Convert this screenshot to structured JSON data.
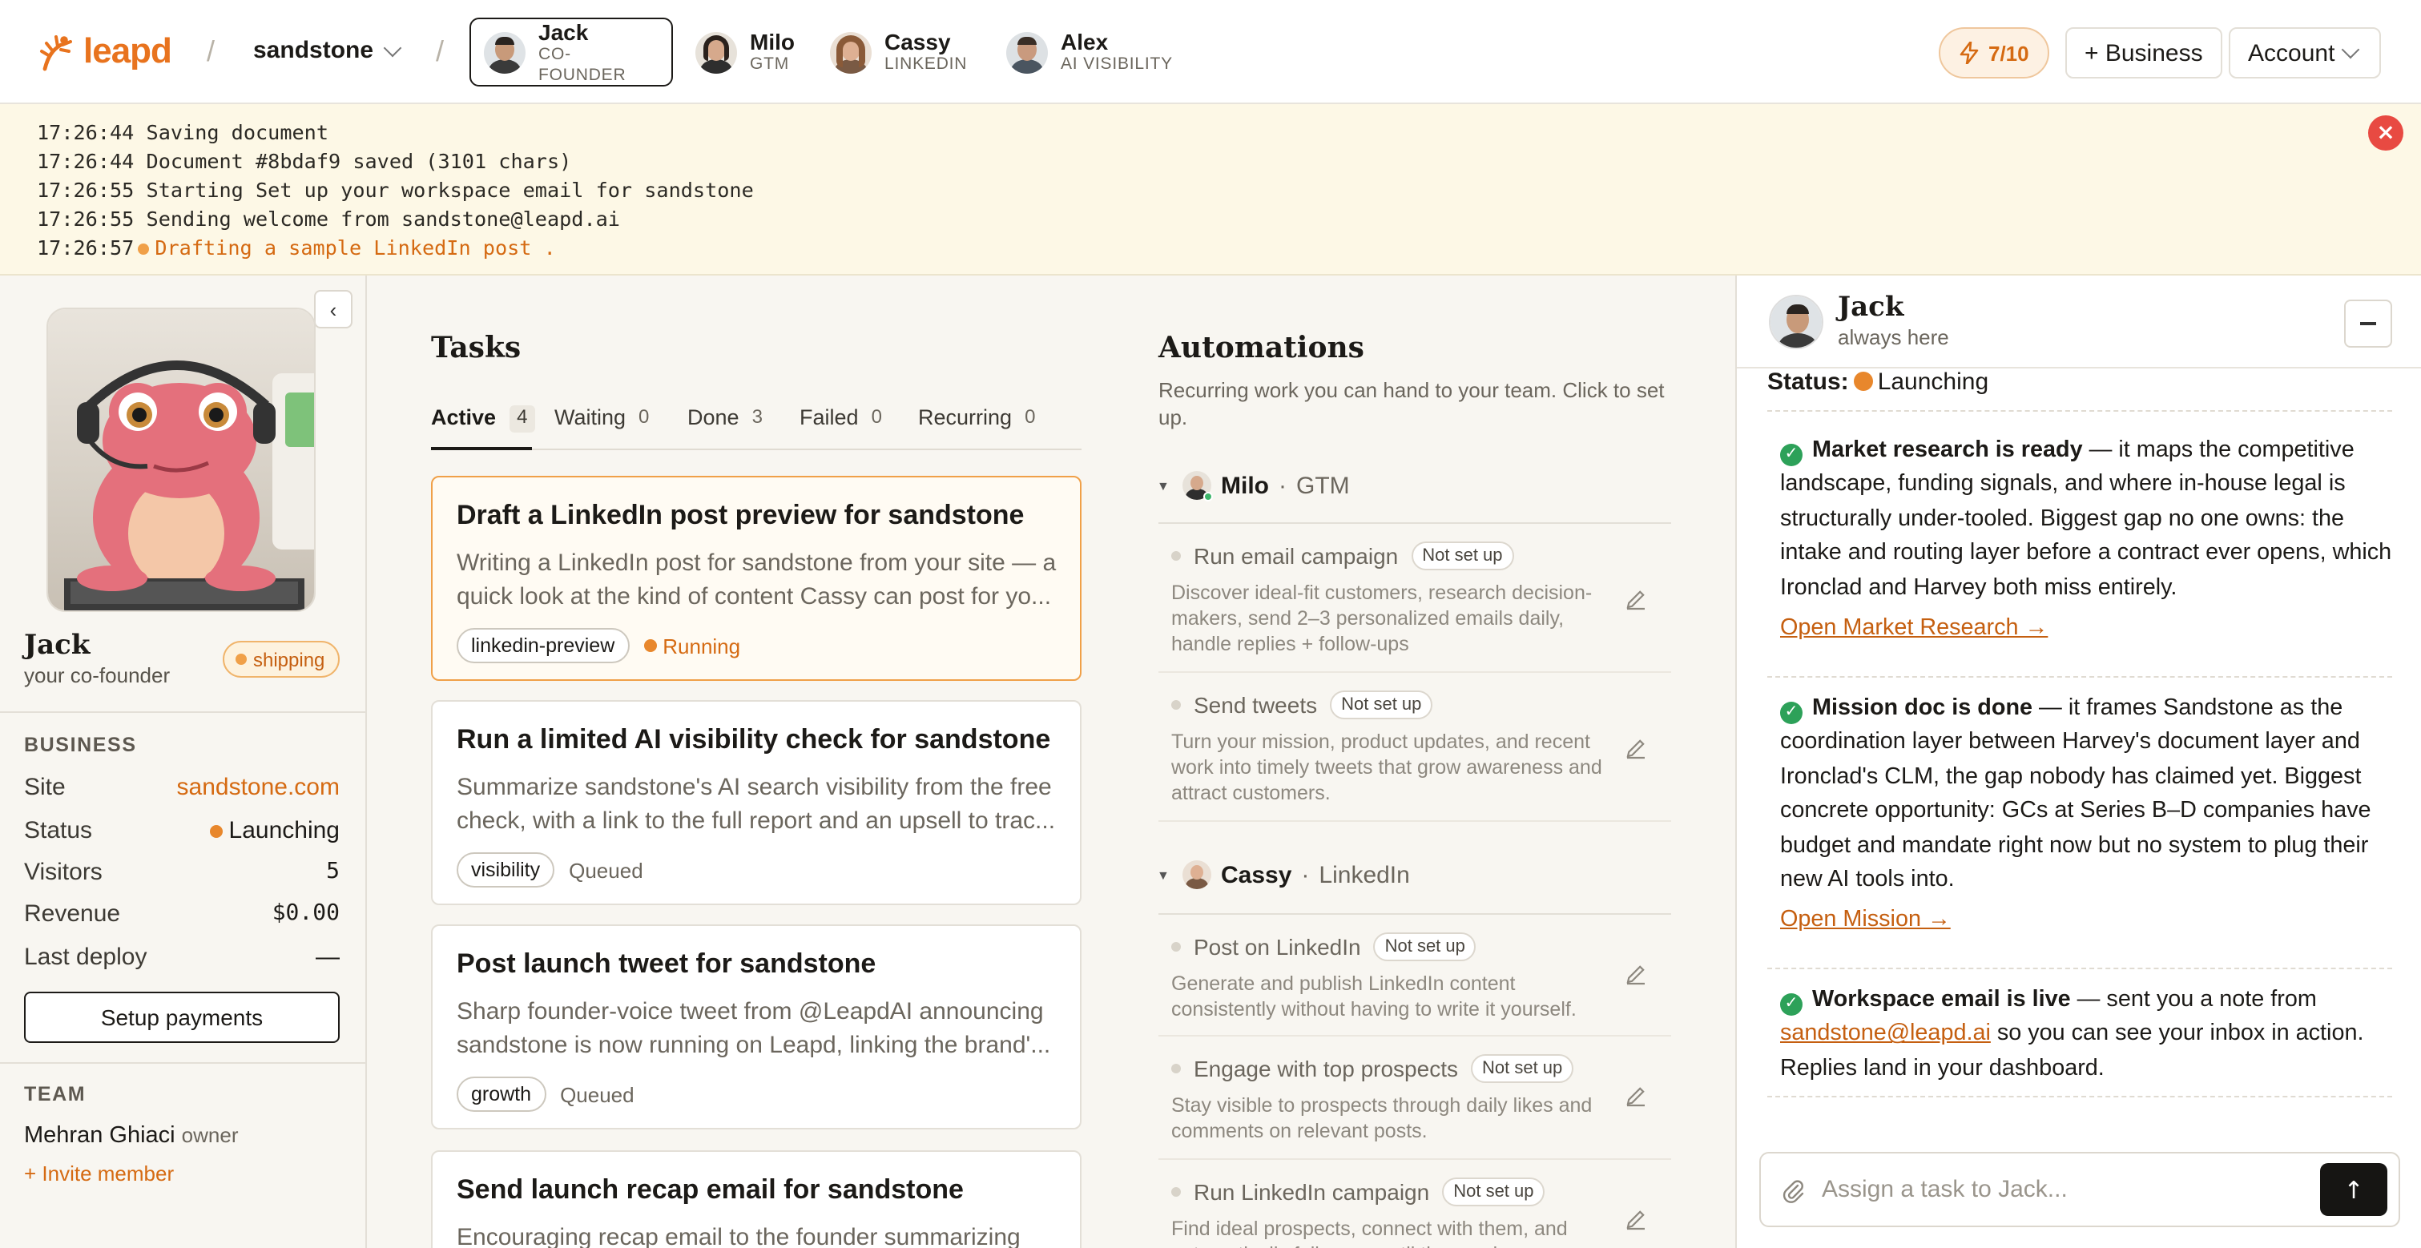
{
  "brand": {
    "name": "leapd",
    "color": "#e8731e"
  },
  "workspace": {
    "name": "sandstone"
  },
  "agents": [
    {
      "name": "Jack",
      "role": "CO-FOUNDER",
      "active": true
    },
    {
      "name": "Milo",
      "role": "GTM",
      "active": false
    },
    {
      "name": "Cassy",
      "role": "LINKEDIN",
      "active": false
    },
    {
      "name": "Alex",
      "role": "AI VISIBILITY",
      "active": false
    }
  ],
  "header": {
    "credits": "7/10",
    "business_button": "+ Business",
    "account_button": "Account"
  },
  "log": {
    "lines": [
      {
        "time": "17:26:44",
        "text": "Saving document"
      },
      {
        "time": "17:26:44",
        "text": "Document #8bdaf9 saved (3101 chars)"
      },
      {
        "time": "17:26:55",
        "text": "Starting Set up your workspace email for sandstone"
      },
      {
        "time": "17:26:55",
        "text": "Sending welcome from sandstone@leapd.ai"
      }
    ],
    "live": {
      "time": "17:26:57",
      "text": "Drafting a sample LinkedIn post",
      "suffix": " ."
    }
  },
  "sidebar": {
    "name": "Jack",
    "subtitle": "your co-founder",
    "badge": "shipping",
    "business_title": "BUSINESS",
    "business": {
      "site_label": "Site",
      "site_value": "sandstone.com",
      "status_label": "Status",
      "status_value": "Launching",
      "visitors_label": "Visitors",
      "visitors_value": "5",
      "revenue_label": "Revenue",
      "revenue_value": "$0.00",
      "deploy_label": "Last deploy",
      "deploy_value": "—"
    },
    "setup_payments": "Setup payments",
    "team_title": "TEAM",
    "member_name": "Mehran Ghiaci",
    "member_role": "owner",
    "invite": "+ Invite member"
  },
  "tasks": {
    "title": "Tasks",
    "tabs": [
      {
        "label": "Active",
        "count": "4"
      },
      {
        "label": "Waiting",
        "count": "0"
      },
      {
        "label": "Done",
        "count": "3"
      },
      {
        "label": "Failed",
        "count": "0"
      },
      {
        "label": "Recurring",
        "count": "0"
      }
    ],
    "items": [
      {
        "title": "Draft a LinkedIn post preview for sandstone",
        "desc1": "Writing a LinkedIn post for sandstone from your site — a",
        "desc2": "quick look at the kind of content Cassy can post for yo...",
        "tag": "linkedin-preview",
        "state": "Running"
      },
      {
        "title": "Run a limited AI visibility check for sandstone",
        "desc1": "Summarize sandstone's AI search visibility from the free",
        "desc2": "check, with a link to the full report and an upsell to trac...",
        "tag": "visibility",
        "state": "Queued"
      },
      {
        "title": "Post launch tweet for sandstone",
        "desc1": "Sharp founder-voice tweet from @LeapdAI announcing",
        "desc2": "sandstone is now running on Leapd, linking the brand'...",
        "tag": "growth",
        "state": "Queued"
      },
      {
        "title": "Send launch recap email for sandstone",
        "desc1": "Encouraging recap email to the founder summarizing",
        "desc2": "",
        "tag": "",
        "state": ""
      }
    ]
  },
  "automations": {
    "title": "Automations",
    "subtitle": "Recurring work you can hand to your team. Click to set up.",
    "groups": [
      {
        "agent": "Milo",
        "role": "GTM",
        "items": [
          {
            "name": "Run email campaign",
            "status": "Not set up",
            "desc": "Discover ideal-fit customers, research decision-makers, send 2–3 personalized emails daily, handle replies + follow-ups"
          },
          {
            "name": "Send tweets",
            "status": "Not set up",
            "desc": "Turn your mission, product updates, and recent work into timely tweets that grow awareness and attract customers."
          }
        ]
      },
      {
        "agent": "Cassy",
        "role": "LinkedIn",
        "items": [
          {
            "name": "Post on LinkedIn",
            "status": "Not set up",
            "desc": "Generate and publish LinkedIn content consistently without having to write it yourself."
          },
          {
            "name": "Engage with top prospects",
            "status": "Not set up",
            "desc": "Stay visible to prospects through daily likes and comments on relevant posts."
          },
          {
            "name": "Run LinkedIn campaign",
            "status": "Not set up",
            "desc": "Find ideal prospects, connect with them, and automatically follow up until they reply."
          }
        ]
      }
    ]
  },
  "chat": {
    "name": "Jack",
    "subtitle": "always here",
    "status_label": "Status:",
    "status_value": "Launching",
    "messages": [
      {
        "bold": "Market research is ready",
        "text": " — it maps the competitive landscape, funding signals, and where in-house legal is structurally under-tooled. Biggest gap no one owns: the intake and routing layer before a contract ever opens, which Ironclad and Harvey both miss entirely.",
        "link": "Open Market Research →"
      },
      {
        "bold": "Mission doc is done",
        "text": " — it frames Sandstone as the coordination layer between Harvey's document layer and Ironclad's CLM, the gap nobody has claimed yet. Biggest concrete opportunity: GCs at Series B–D companies have budget and mandate right now but no system to plug their new AI tools into.",
        "link": "Open Mission →"
      },
      {
        "bold": "Workspace email is live",
        "text_before": " — sent you a note from ",
        "email": "sandstone@leapd.ai",
        "text_after": " so you can see your inbox in action. Replies land in your dashboard."
      }
    ],
    "placeholder": "Assign a task to Jack..."
  }
}
